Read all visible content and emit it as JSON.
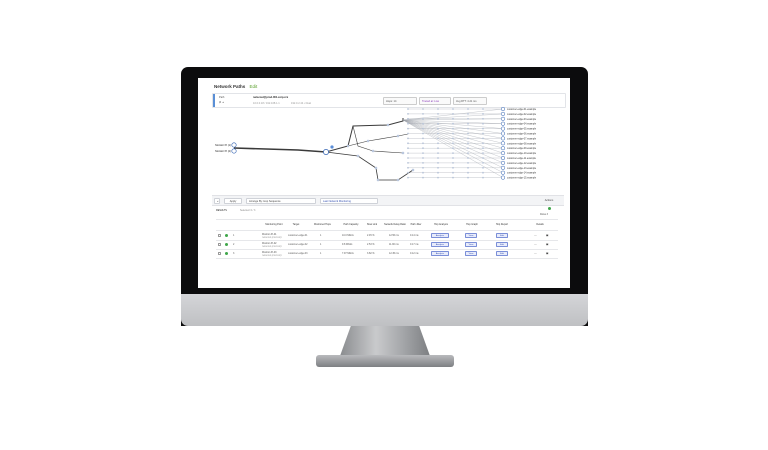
{
  "header": {
    "title": "Network Paths",
    "edit_label": "Edit"
  },
  "info": {
    "type_label": "Path",
    "source": "netscout@prod-001.corp.rcx",
    "source_sub": "10.0.0.18 / 192.168.1.1",
    "target_sub": "192.0.2.44  •  Dual",
    "hops_label": "Hops: 14",
    "tracked_label": "Traced at: Live",
    "rtt_label": "Avg RTT: 4.21 ms"
  },
  "graph": {
    "source_labels": [
      "Monitor Pt (1)",
      "Monitor Pt (2)"
    ],
    "dest_labels": [
      "customer-edge-01.example",
      "customer-edge-02.example",
      "customer-edge-03.example",
      "customer-edge-04.example",
      "customer-edge-05.example",
      "customer-edge-06.example",
      "customer-edge-07.example",
      "customer-edge-08.example",
      "customer-edge-09.example",
      "customer-edge-10.example",
      "customer-edge-11.example",
      "customer-edge-12.example",
      "customer-edge-13.example",
      "customer-edge-14.example",
      "customer-edge-15.example"
    ]
  },
  "toolbar": {
    "collapse_label": "«",
    "apply_label": "Apply",
    "arrange_label": "Arrange By: Hop Sequence",
    "monitoring_label": "Last Network Monitoring",
    "actions_label": "Actions"
  },
  "table": {
    "section_label": "RESULTS",
    "sub_label": "Selected: 0 / 3",
    "page_label": "Rows 3",
    "columns": [
      "Monitoring Point",
      "Target",
      "Monitored Hops",
      "Path Capacity",
      "Slow Link",
      "Network Delay Ratio",
      "Path Jitter",
      "Hop Analysis",
      "Hop Graph",
      "Hop Report",
      "Details"
    ],
    "rows": [
      {
        "idx": "1",
        "name": "Monitor-Pt-01",
        "sub": "netscout.prod.corp",
        "target": "customer-edge-01",
        "hops": "1",
        "capacity": "10.0 Mbit/s",
        "slow": "2.45 %",
        "delay": "12.56 ms",
        "jitter": "0.14 ms",
        "btn1": "Analysis",
        "btn2": "View",
        "btn3": "Edit"
      },
      {
        "idx": "2",
        "name": "Monitor-Pt-02",
        "sub": "netscout.prod.corp",
        "target": "customer-edge-02",
        "hops": "1",
        "capacity": "9.8 Mbit/s",
        "slow": "2.53 %",
        "delay": "11.90 ms",
        "jitter": "0.17 ms",
        "btn1": "Analysis",
        "btn2": "View",
        "btn3": "Edit"
      },
      {
        "idx": "3",
        "name": "Monitor-Pt-03",
        "sub": "netscout.prod.corp",
        "target": "customer-edge-03",
        "hops": "1",
        "capacity": "7.97 Mbit/s",
        "slow": "3.82 %",
        "delay": "12.45 ms",
        "jitter": "0.12 ms",
        "btn1": "Analysis",
        "btn2": "View",
        "btn3": "Edit"
      }
    ]
  }
}
